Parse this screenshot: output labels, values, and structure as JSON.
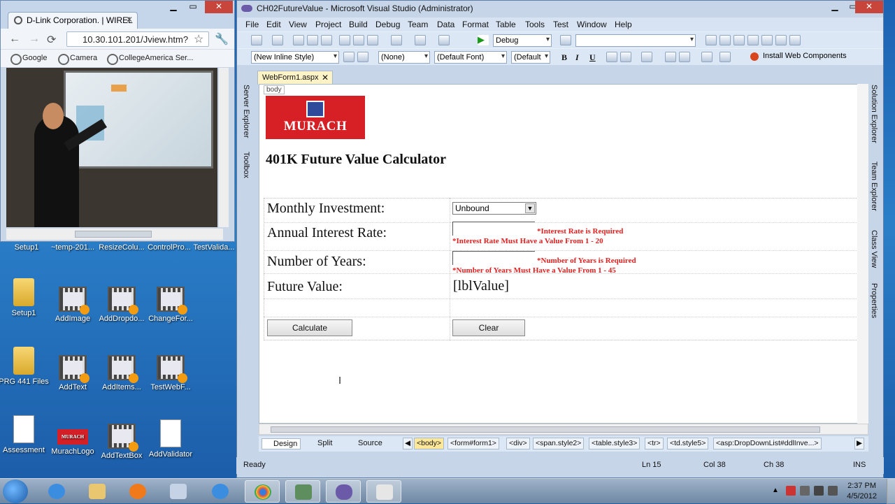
{
  "browser": {
    "tab_title": "D-Link Corporation. | WIREL",
    "url": "10.30.101.201/Jview.htm?",
    "bookmarks": [
      "Google",
      "Camera",
      "CollegeAmerica Ser..."
    ]
  },
  "desktop": {
    "top_labels": [
      "Setup1",
      "~temp-201...",
      "ResizeColu...",
      "ControlPro...",
      "TestValida..."
    ],
    "icons": [
      {
        "label": "Setup1"
      },
      {
        "label": "AddImage"
      },
      {
        "label": "AddDropdo..."
      },
      {
        "label": "ChangeFor..."
      },
      {
        "label": "PRG 441 Files"
      },
      {
        "label": "AddText"
      },
      {
        "label": "AddItems..."
      },
      {
        "label": "TestWebF..."
      },
      {
        "label": "Assessment"
      },
      {
        "label": "MurachLogo"
      },
      {
        "label": "AddTextBox"
      },
      {
        "label": "AddValidator"
      }
    ]
  },
  "vs": {
    "title": "CH02FutureValue - Microsoft Visual Studio (Administrator)",
    "menu": [
      "File",
      "Edit",
      "View",
      "Project",
      "Build",
      "Debug",
      "Team",
      "Data",
      "Format",
      "Table",
      "Tools",
      "Test",
      "Window",
      "Help"
    ],
    "toolbar": {
      "config": "Debug",
      "style_combo": "(New Inline Style)",
      "none_combo": "(None)",
      "font_combo": "(Default Font)",
      "size_combo": "(Default",
      "bold": "B",
      "italic": "I",
      "underline": "U",
      "install": "Install Web Components"
    },
    "left_panels": [
      "Server Explorer",
      "Toolbox"
    ],
    "right_panels": [
      "Solution Explorer",
      "Team Explorer",
      "Class View",
      "Properties"
    ],
    "doc_tab": "WebForm1.aspx",
    "body_tag": "body",
    "page": {
      "logo_text": "MURACH",
      "heading": "401K Future Value Calculator",
      "labels": {
        "monthly": "Monthly Investment:",
        "rate": "Annual Interest Rate:",
        "years": "Number of Years:",
        "future": "Future Value:"
      },
      "ddl_value": "Unbound",
      "errors": {
        "rate_required": "*Interest Rate is Required",
        "rate_range": "*Interest Rate Must Have a Value From 1 - 20",
        "years_required": "*Number of Years is Required",
        "years_range": "*Number of Years Must Have a Value From 1 - 45"
      },
      "lbl_value": "[lblValue]",
      "calculate": "Calculate",
      "clear": "Clear"
    },
    "views": [
      "Design",
      "Split",
      "Source"
    ],
    "breadcrumbs": [
      "<body>",
      "<form#form1>",
      "<div>",
      "<span.style2>",
      "<table.style3>",
      "<tr>",
      "<td.style5>",
      "<asp:DropDownList#ddlInve...>"
    ],
    "status": {
      "ready": "Ready",
      "ln": "Ln 15",
      "col": "Col 38",
      "ch": "Ch 38",
      "ins": "INS"
    }
  },
  "taskbar": {
    "time": "2:37 PM",
    "date": "4/5/2012"
  }
}
